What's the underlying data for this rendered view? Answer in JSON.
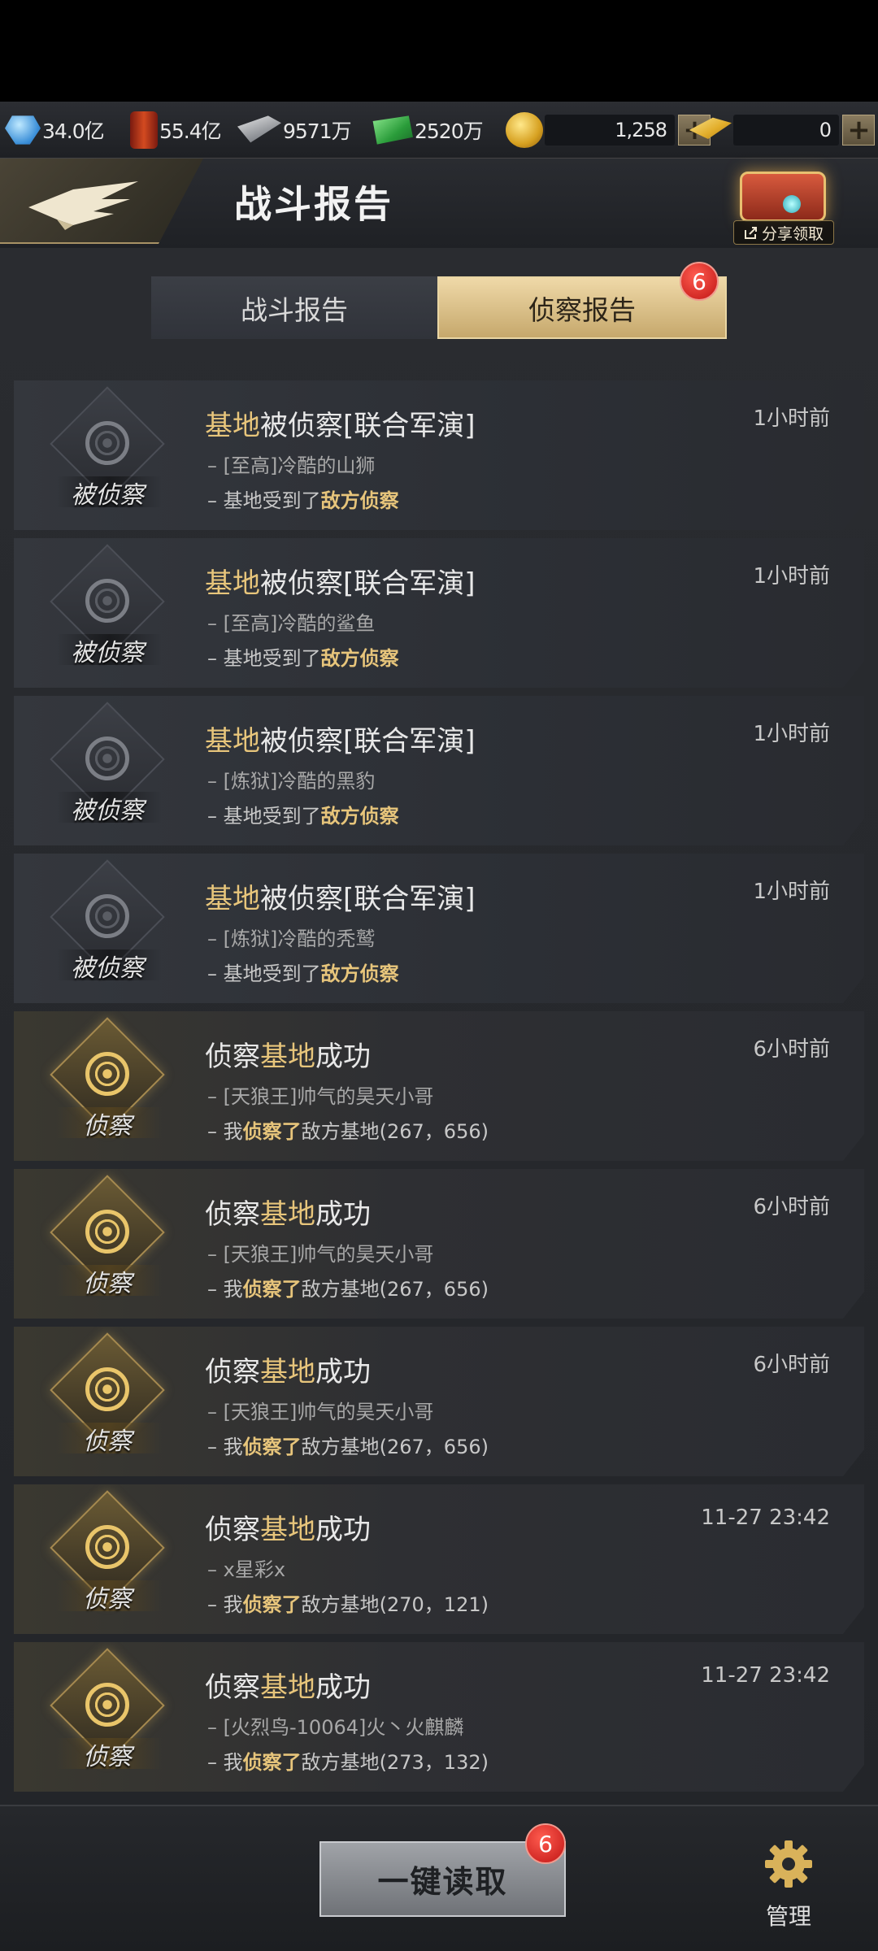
{
  "resources": {
    "crystal": "34.0亿",
    "oil": "55.4亿",
    "steel": "9571万",
    "cash": "2520万",
    "gold_coins": "1,258",
    "gold_bars": "0"
  },
  "header": {
    "title": "战斗报告",
    "share_label": "分享领取"
  },
  "tabs": [
    {
      "label": "战斗报告",
      "active": false
    },
    {
      "label": "侦察报告",
      "active": true,
      "badge": "6"
    }
  ],
  "reports": [
    {
      "type": "scouted",
      "emblem": "被侦察",
      "title_hl": "基地",
      "title_rest": "被侦察[联合军演]",
      "time": "1小时前",
      "line1": "– [至高]冷酷的山狮",
      "line2_pre": "– 基地受到了",
      "line2_em": "敌方侦察",
      "line2_post": ""
    },
    {
      "type": "scouted",
      "emblem": "被侦察",
      "title_hl": "基地",
      "title_rest": "被侦察[联合军演]",
      "time": "1小时前",
      "line1": "– [至高]冷酷的鲨鱼",
      "line2_pre": "– 基地受到了",
      "line2_em": "敌方侦察",
      "line2_post": ""
    },
    {
      "type": "scouted",
      "emblem": "被侦察",
      "title_hl": "基地",
      "title_rest": "被侦察[联合军演]",
      "time": "1小时前",
      "line1": "– [炼狱]冷酷的黑豹",
      "line2_pre": "– 基地受到了",
      "line2_em": "敌方侦察",
      "line2_post": ""
    },
    {
      "type": "scouted",
      "emblem": "被侦察",
      "title_hl": "基地",
      "title_rest": "被侦察[联合军演]",
      "time": "1小时前",
      "line1": "– [炼狱]冷酷的秃鹫",
      "line2_pre": "– 基地受到了",
      "line2_em": "敌方侦察",
      "line2_post": ""
    },
    {
      "type": "success",
      "emblem": "侦察",
      "title_pre": "侦察",
      "title_hl": "基地",
      "title_rest": "成功",
      "time": "6小时前",
      "line1": "– [天狼王]帅气的昊天小哥",
      "line2_pre": "– 我",
      "line2_em": "侦察了",
      "line2_post": "敌方基地(267，656)"
    },
    {
      "type": "success",
      "emblem": "侦察",
      "title_pre": "侦察",
      "title_hl": "基地",
      "title_rest": "成功",
      "time": "6小时前",
      "line1": "– [天狼王]帅气的昊天小哥",
      "line2_pre": "– 我",
      "line2_em": "侦察了",
      "line2_post": "敌方基地(267，656)"
    },
    {
      "type": "success",
      "emblem": "侦察",
      "title_pre": "侦察",
      "title_hl": "基地",
      "title_rest": "成功",
      "time": "6小时前",
      "line1": "– [天狼王]帅气的昊天小哥",
      "line2_pre": "– 我",
      "line2_em": "侦察了",
      "line2_post": "敌方基地(267，656)"
    },
    {
      "type": "success",
      "emblem": "侦察",
      "title_pre": "侦察",
      "title_hl": "基地",
      "title_rest": "成功",
      "time": "11-27 23:42",
      "line1": "– x星彩x",
      "line2_pre": "– 我",
      "line2_em": "侦察了",
      "line2_post": "敌方基地(270，121)"
    },
    {
      "type": "success",
      "emblem": "侦察",
      "title_pre": "侦察",
      "title_hl": "基地",
      "title_rest": "成功",
      "time": "11-27 23:42",
      "line1": "– [火烈鸟-10064]火丶火麒麟",
      "line2_pre": "– 我",
      "line2_em": "侦察了",
      "line2_post": "敌方基地(273，132)"
    }
  ],
  "bottom": {
    "read_all_label": "一键读取",
    "read_all_badge": "6",
    "manage_label": "管理"
  }
}
